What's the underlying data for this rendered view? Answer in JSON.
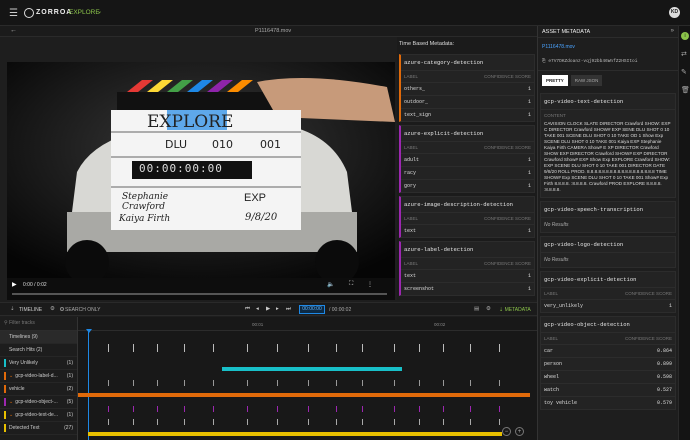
{
  "app": {
    "logo": "ZORROA",
    "nav": "EXPLORE",
    "avatar": "KD",
    "nav_arrow": "⌄",
    "brand_colors": {
      "accent": "#8bc34a",
      "teal": "#18bfc8",
      "orange": "#e06a0a",
      "yellow": "#e8c000",
      "purple": "#9c27b0"
    }
  },
  "file": {
    "name": "P1116478.mov"
  },
  "tbm": {
    "title": "Time Based Metadata:",
    "cards": [
      {
        "title": "azure-category-detection",
        "label_h": "LABEL",
        "conf_h": "CONFIDENCE SCORE",
        "rows": [
          [
            "others_",
            "1"
          ],
          [
            "outdoor_",
            "1"
          ],
          [
            "text_sign",
            "1"
          ]
        ],
        "accent": "#e06a0a"
      },
      {
        "title": "azure-explicit-detection",
        "label_h": "LABEL",
        "conf_h": "CONFIDENCE SCORE",
        "rows": [
          [
            "adult",
            "1"
          ],
          [
            "racy",
            "1"
          ],
          [
            "gory",
            "1"
          ]
        ],
        "accent": "#9c27b0"
      },
      {
        "title": "azure-image-description-detection",
        "label_h": "LABEL",
        "conf_h": "CONFIDENCE SCORE",
        "rows": [
          [
            "text",
            "1"
          ]
        ],
        "accent": "#9c27b0"
      },
      {
        "title": "azure-label-detection",
        "label_h": "LABEL",
        "conf_h": "CONFIDENCE SCORE",
        "rows": [
          [
            "text",
            "1"
          ],
          [
            "screenshot",
            "1"
          ]
        ],
        "accent": "#9c27b0"
      }
    ]
  },
  "video": {
    "time": "0:00 / 0:02",
    "slate": {
      "title": "EXPLORE",
      "roll": "DLU",
      "scene": "010",
      "take": "001",
      "director": "Stephanie Crawford",
      "camera": "Kaiya Firth",
      "show": "EXP",
      "date": "9/8/20",
      "timecode": "00:00:00:00"
    }
  },
  "timeline": {
    "label": "TIMELINE",
    "search_only": "SEARCH ONLY",
    "current": "00:00:00",
    "duration": "/ 00:00:02",
    "metadata": "METADATA",
    "filter_placeholder": "Filter tracks",
    "ruler": [
      "00:01",
      "00:02"
    ],
    "tracks": [
      {
        "name": "Timelines (9)",
        "count": ""
      },
      {
        "name": "Search Hits (2)",
        "count": ""
      },
      {
        "name": "Very Unlikely",
        "count": "(1)"
      },
      {
        "name": "gcp-video-label-d...",
        "count": "(1)"
      },
      {
        "name": "vehicle",
        "count": "(2)"
      },
      {
        "name": "gcp-video-object-...",
        "count": "(5)"
      },
      {
        "name": "gcp-video-text-de...",
        "count": "(1)"
      },
      {
        "name": "Detected Text",
        "count": "(27)"
      }
    ]
  },
  "meta": {
    "title": "ASSET METADATA",
    "file": "P1116478.mov",
    "id": "e7V7DKZdoanz-vqj92bb46WnfZ2HSItoi",
    "tabs": [
      "PRETTY",
      "RAW JSON"
    ],
    "text_detection": {
      "title": "gcp-video-text-detection",
      "label": "CONTENT",
      "content": "CAVISION CLOCK SLATE DIRECTOR Crawford SHOW: EXP C DIRECTOR Crawford SHOW# EXP SENE DLU SHOT 0 10 TAKE 001 SCENE DLU SHOT 0 10 TAKE OD 1 Show Exp SCENE DLU SHOT 0 10 TAKE 001 Kaiya EXP Stephanie Kaiya Firth CAMERA Show# E XP DIRECTOR Crawford SHOW EXP DIRECTOR Crawford SHOW# EXP DIRECTOR Crawford Show# EXP Show Exp EXPLORE Crawford SHOW: EXP SCENE DLU SHOT 0 10 TAKE 001 DIRECTOR DATE 9/8/20 ROLL PROD. 8.8.8.8.8.8.8.8.8.8.8.8.8.8.8.8.8.8 TIME SHOW# Exp SCENE DLU SHOT 0 10 TAKE 001 Show# Exp Firth 8.8.8.8. :8.8.8.8. Crawford PROD EXPLORE 8.8.8.8. :8.8.8.8."
    },
    "speech": {
      "title": "gcp-video-speech-transcription",
      "value": "No Results"
    },
    "logo": {
      "title": "gcp-video-logo-detection",
      "value": "No Results"
    },
    "explicit": {
      "title": "gcp-video-explicit-detection",
      "label_h": "LABEL",
      "conf_h": "CONFIDENCE SCORE",
      "rows": [
        [
          "very_unlikely",
          "1"
        ]
      ]
    },
    "object": {
      "title": "gcp-video-object-detection",
      "label_h": "LABEL",
      "conf_h": "CONFIDENCE SCORE",
      "rows": [
        [
          "car",
          "0.864"
        ],
        [
          "person",
          "0.899"
        ],
        [
          "wheel",
          "0.598"
        ],
        [
          "watch",
          "0.527"
        ],
        [
          "toy vehicle",
          "0.579"
        ]
      ]
    }
  }
}
